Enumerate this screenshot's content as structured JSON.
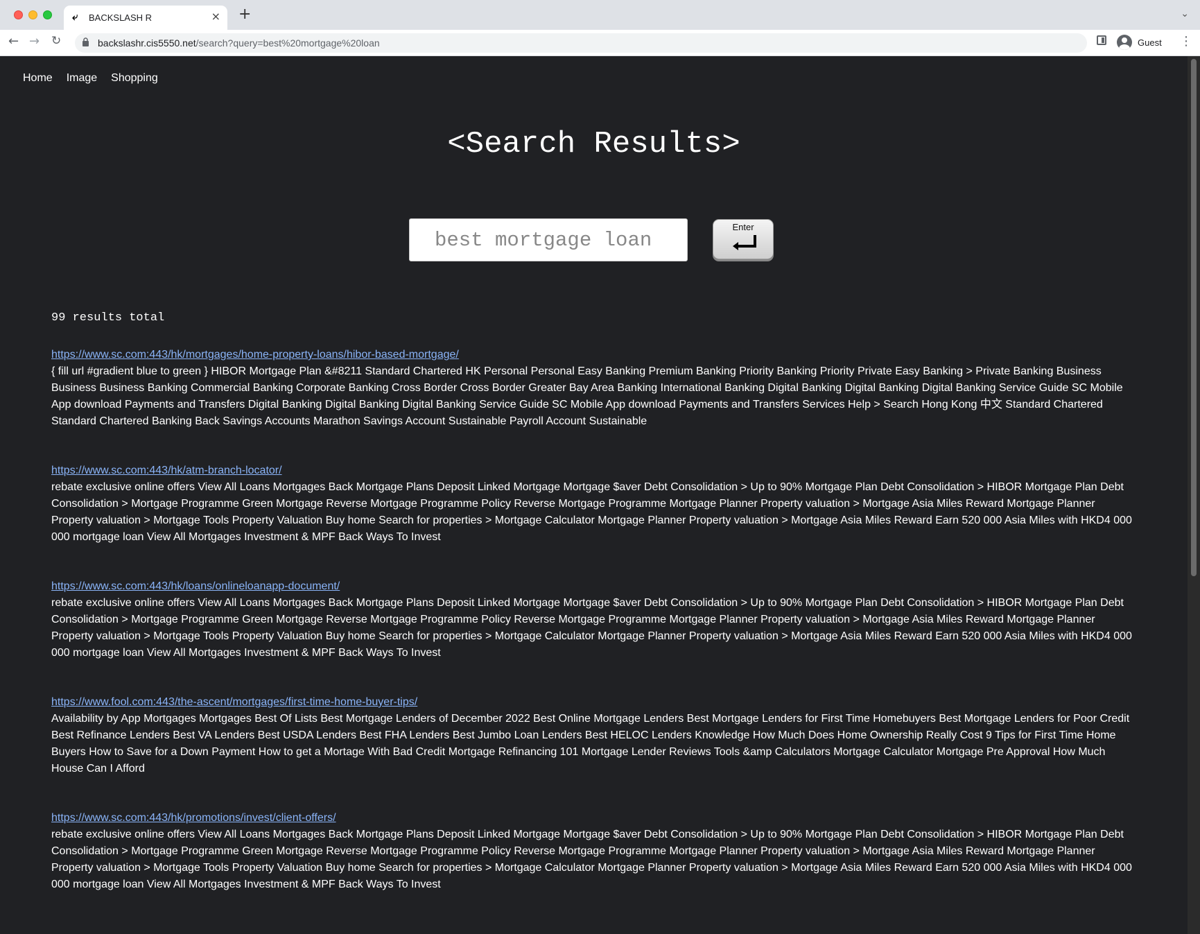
{
  "browser": {
    "tab_title": "BACKSLASH R",
    "url_host": "backslashr.cis5550.net",
    "url_path": "/search?query=best%20mortgage%20loan",
    "profile_name": "Guest"
  },
  "nav": {
    "home": "Home",
    "image": "Image",
    "shopping": "Shopping"
  },
  "heading": "<Search Results>",
  "search": {
    "value": "best mortgage loan",
    "enter_label": "Enter"
  },
  "results_total": "99 results total",
  "results": [
    {
      "url": "https://www.sc.com:443/hk/mortgages/home-property-loans/hibor-based-mortgage/",
      "snippet": "{ fill url #gradient blue to green } HIBOR Mortgage Plan &#8211 Standard Chartered HK Personal Personal Easy Banking Premium Banking Priority Banking Priority Private Easy Banking > Private Banking Business Business Business Banking Commercial Banking Corporate Banking Cross Border Cross Border Greater Bay Area Banking International Banking Digital Banking Digital Banking Digital Banking Service Guide SC Mobile App download Payments and Transfers Digital Banking Digital Banking Digital Banking Service Guide SC Mobile App download Payments and Transfers Services Help > Search Hong Kong 中文 Standard Chartered Standard Chartered Banking Back Savings Accounts Marathon Savings Account Sustainable Payroll Account Sustainable"
    },
    {
      "url": "https://www.sc.com:443/hk/atm-branch-locator/",
      "snippet": "rebate exclusive online offers View All Loans Mortgages Back Mortgage Plans Deposit Linked Mortgage Mortgage $aver Debt Consolidation > Up to 90% Mortgage Plan Debt Consolidation > HIBOR Mortgage Plan Debt Consolidation > Mortgage Programme Green Mortgage Reverse Mortgage Programme Policy Reverse Mortgage Programme Mortgage Planner Property valuation > Mortgage Asia Miles Reward Mortgage Planner Property valuation > Mortgage Tools Property Valuation Buy home Search for properties > Mortgage Calculator Mortgage Planner Property valuation > Mortgage Asia Miles Reward Earn 520 000 Asia Miles with HKD4 000 000 mortgage loan View All Mortgages Investment & MPF Back Ways To Invest"
    },
    {
      "url": "https://www.sc.com:443/hk/loans/onlineloanapp-document/",
      "snippet": "rebate exclusive online offers View All Loans Mortgages Back Mortgage Plans Deposit Linked Mortgage Mortgage $aver Debt Consolidation > Up to 90% Mortgage Plan Debt Consolidation > HIBOR Mortgage Plan Debt Consolidation > Mortgage Programme Green Mortgage Reverse Mortgage Programme Policy Reverse Mortgage Programme Mortgage Planner Property valuation > Mortgage Asia Miles Reward Mortgage Planner Property valuation > Mortgage Tools Property Valuation Buy home Search for properties > Mortgage Calculator Mortgage Planner Property valuation > Mortgage Asia Miles Reward Earn 520 000 Asia Miles with HKD4 000 000 mortgage loan View All Mortgages Investment & MPF Back Ways To Invest"
    },
    {
      "url": "https://www.fool.com:443/the-ascent/mortgages/first-time-home-buyer-tips/",
      "snippet": "Availability by App Mortgages Mortgages Best Of Lists Best Mortgage Lenders of December 2022 Best Online Mortgage Lenders Best Mortgage Lenders for First Time Homebuyers Best Mortgage Lenders for Poor Credit Best Refinance Lenders Best VA Lenders Best USDA Lenders Best FHA Lenders Best Jumbo Loan Lenders Best HELOC Lenders Knowledge How Much Does Home Ownership Really Cost 9 Tips for First Time Home Buyers How to Save for a Down Payment How to get a Mortage With Bad Credit Mortgage Refinancing 101 Mortgage Lender Reviews Tools &amp Calculators Mortgage Calculator Mortgage Pre Approval How Much House Can I Afford"
    },
    {
      "url": "https://www.sc.com:443/hk/promotions/invest/client-offers/",
      "snippet": "rebate exclusive online offers View All Loans Mortgages Back Mortgage Plans Deposit Linked Mortgage Mortgage $aver Debt Consolidation > Up to 90% Mortgage Plan Debt Consolidation > HIBOR Mortgage Plan Debt Consolidation > Mortgage Programme Green Mortgage Reverse Mortgage Programme Policy Reverse Mortgage Programme Mortgage Planner Property valuation > Mortgage Asia Miles Reward Mortgage Planner Property valuation > Mortgage Tools Property Valuation Buy home Search for properties > Mortgage Calculator Mortgage Planner Property valuation > Mortgage Asia Miles Reward Earn 520 000 Asia Miles with HKD4 000 000 mortgage loan View All Mortgages Investment & MPF Back Ways To Invest"
    }
  ]
}
